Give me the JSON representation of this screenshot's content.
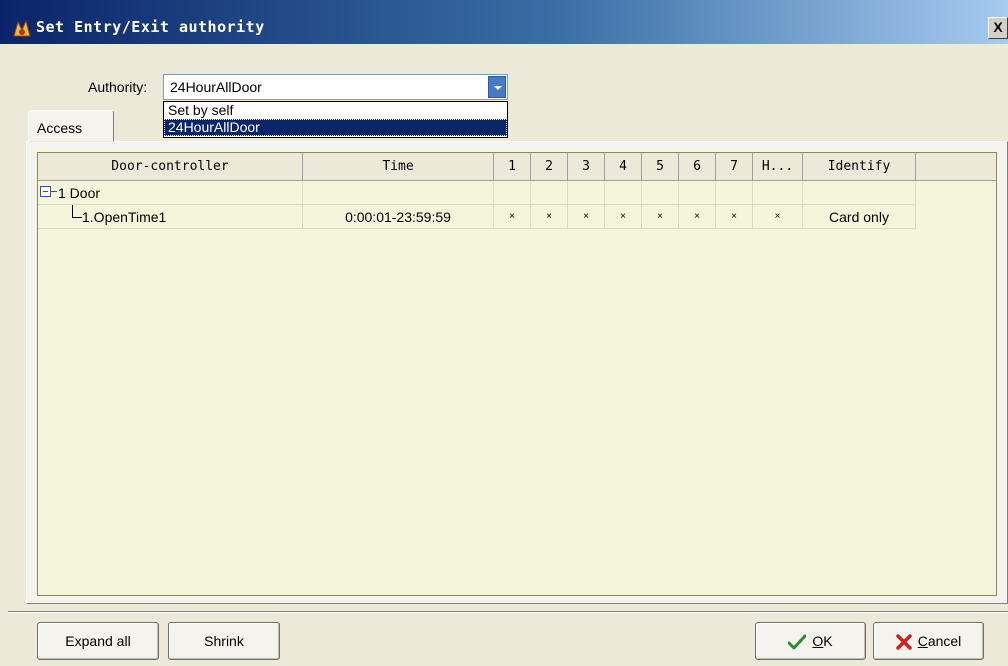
{
  "window": {
    "title": "Set Entry/Exit authority",
    "close_glyph": "X"
  },
  "authority": {
    "label": "Authority:",
    "selected": "24HourAllDoor",
    "options": [
      "Set by self",
      "24HourAllDoor"
    ]
  },
  "tabs": [
    {
      "label": "Access"
    }
  ],
  "grid": {
    "columns": [
      "Door-controller",
      "Time",
      "1",
      "2",
      "3",
      "4",
      "5",
      "6",
      "7",
      "H...",
      "Identify"
    ],
    "rows": [
      {
        "door": "1 Door",
        "time": "",
        "days": [
          "",
          "",
          "",
          "",
          "",
          "",
          "",
          ""
        ],
        "identify": ""
      },
      {
        "door": "1.OpenTime1",
        "time": "0:00:01-23:59:59",
        "days": [
          "×",
          "×",
          "×",
          "×",
          "×",
          "×",
          "×",
          "×"
        ],
        "identify": "Card only"
      }
    ]
  },
  "buttons": {
    "expand_all": "Expand all",
    "shrink": "Shrink",
    "ok_mnemonic": "O",
    "ok_rest": "K",
    "cancel_mnemonic": "C",
    "cancel_rest": "ancel"
  },
  "colors": {
    "titlebar_start": "#0a246a",
    "grid_background": "#f5f5dc",
    "ok_check": "#2e8b2e",
    "cancel_x": "#d02020"
  },
  "icons": {
    "title": "app-logo-icon",
    "ok": "check-icon",
    "cancel": "x-icon",
    "tree_collapse": "tree-collapse-icon",
    "dropdown": "chevron-down-icon"
  }
}
